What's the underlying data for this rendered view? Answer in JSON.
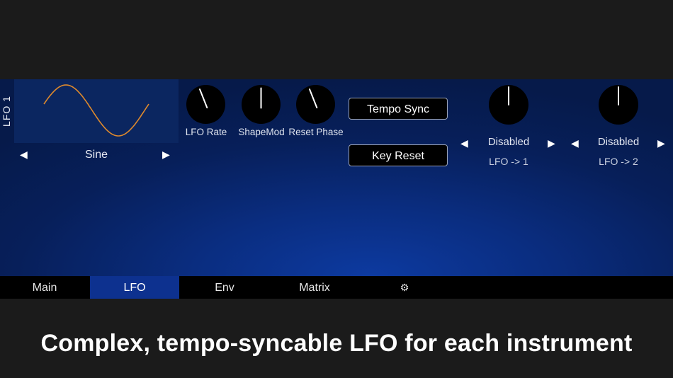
{
  "lfo": {
    "title": "LFO 1",
    "waveform": {
      "shape": "Sine",
      "prev_arrow": "◀",
      "next_arrow": "▶",
      "curve_color": "#e08a2c"
    },
    "knobs": [
      {
        "label": "LFO Rate",
        "value_fraction": 0.42
      },
      {
        "label": "ShapeMod",
        "value_fraction": 0.5
      },
      {
        "label": "Reset Phase",
        "value_fraction": 0.42
      }
    ],
    "buttons": {
      "tempo_sync": "Tempo Sync",
      "key_reset": "Key Reset"
    },
    "destinations": [
      {
        "value": "Disabled",
        "label": "LFO -> 1",
        "prev_arrow": "◀",
        "next_arrow": "▶",
        "amount_fraction": 0.5
      },
      {
        "value": "Disabled",
        "label": "LFO -> 2",
        "prev_arrow": "◀",
        "next_arrow": "▶",
        "amount_fraction": 0.5
      }
    ]
  },
  "tabs": [
    {
      "label": "Main",
      "active": false
    },
    {
      "label": "LFO",
      "active": true
    },
    {
      "label": "Env",
      "active": false
    },
    {
      "label": "Matrix",
      "active": false
    },
    {
      "label": "⚙",
      "icon": "gear-icon",
      "active": false
    }
  ],
  "caption": "Complex, tempo-syncable LFO for each instrument",
  "colors": {
    "accent": "#0d318f",
    "panel_dark": "#061a4a",
    "background": "#1b1b1b"
  }
}
